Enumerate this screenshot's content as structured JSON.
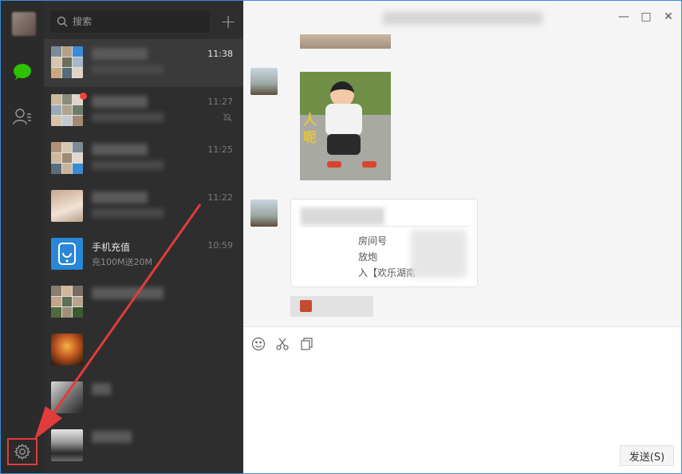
{
  "search": {
    "placeholder": "搜索"
  },
  "add_button_label": "+",
  "conversations": [
    {
      "name": "",
      "preview": "",
      "time": "11:38",
      "active": true
    },
    {
      "name": "",
      "preview": "",
      "time": "11:27",
      "unread": true,
      "muted": true
    },
    {
      "name": "",
      "preview": "",
      "time": "11:25"
    },
    {
      "name": "",
      "preview": "",
      "time": "11:22"
    },
    {
      "name": "手机充值",
      "preview": "充100M送20M",
      "time": "10:59"
    },
    {
      "name": "",
      "preview": "",
      "time": ""
    },
    {
      "name": "",
      "preview": "",
      "time": ""
    },
    {
      "name": "",
      "preview": "",
      "time": ""
    },
    {
      "name": "",
      "preview": "",
      "time": ""
    }
  ],
  "chat": {
    "photo_caption": "人呢",
    "card_lines": [
      "房间号",
      "放炮",
      "入【欢乐湖南"
    ]
  },
  "window_controls": {
    "minimize": "—",
    "maximize": "□",
    "close": "✕"
  },
  "composer": {
    "send_label": "发送(S)"
  },
  "colors": {
    "accent_green": "#2dc100",
    "annotation_red": "#e23b3b",
    "unread_red": "#f44336"
  }
}
